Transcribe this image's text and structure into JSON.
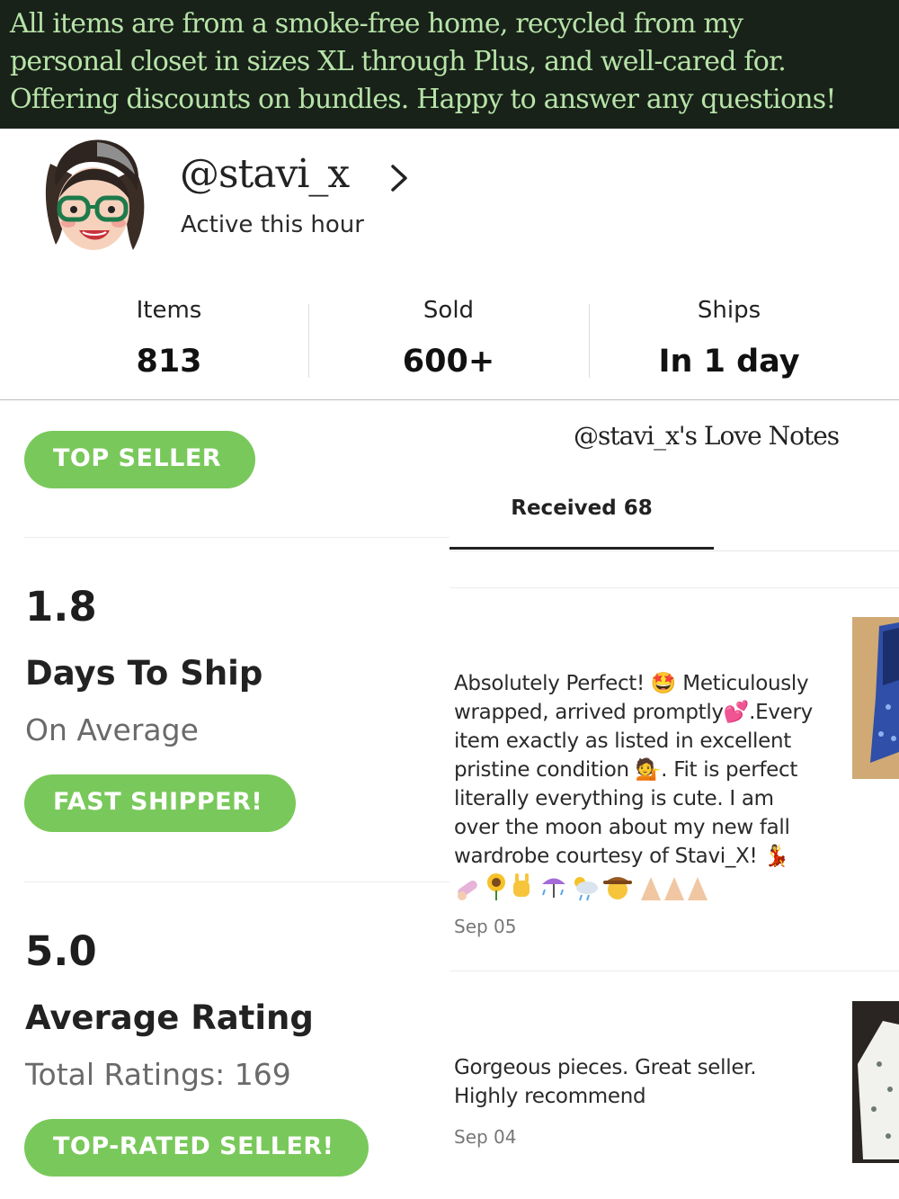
{
  "banner": {
    "lines": [
      "All items are from a smoke-free home, recycled from my",
      "personal closet in sizes XL through Plus, and well-cared for.",
      "Offering discounts on bundles. Happy to answer any questions!"
    ]
  },
  "profile": {
    "username": "@stavi_x",
    "status": "Active this hour"
  },
  "stats": [
    {
      "label": "Items",
      "value": "813"
    },
    {
      "label": "Sold",
      "value": "600+"
    },
    {
      "label": "Ships",
      "value": "In 1 day"
    }
  ],
  "badges": {
    "top_seller": "TOP SELLER",
    "fast_shipper": "FAST SHIPPER!",
    "top_rated": "TOP-RATED SELLER!"
  },
  "metrics": {
    "ship": {
      "value": "1.8",
      "title": "Days To Ship",
      "sub": "On Average"
    },
    "rating": {
      "value": "5.0",
      "title": "Average Rating",
      "sub": "Total Ratings: 169"
    }
  },
  "love_notes": {
    "title": "@stavi_x's Love Notes",
    "tab_received": "Received 68",
    "reviews": [
      {
        "lines": [
          "Absolutely Perfect! 🤩 Meticulously",
          "wrapped, arrived promptly💕.Every",
          "item exactly as listed in excellent",
          "pristine condition 💁. Fit is perfect",
          "literally everything is cute. I am",
          "over the moon about my new fall",
          "wardrobe courtesy of Stavi_X! 💃"
        ],
        "date": "Sep 05"
      },
      {
        "lines": [
          "Gorgeous pieces. Great seller.",
          "Highly recommend"
        ],
        "date": "Sep 04"
      }
    ]
  },
  "colors": {
    "banner_bg": "#182219",
    "banner_text": "#b7e3a8",
    "badge_green": "#79c85b"
  }
}
